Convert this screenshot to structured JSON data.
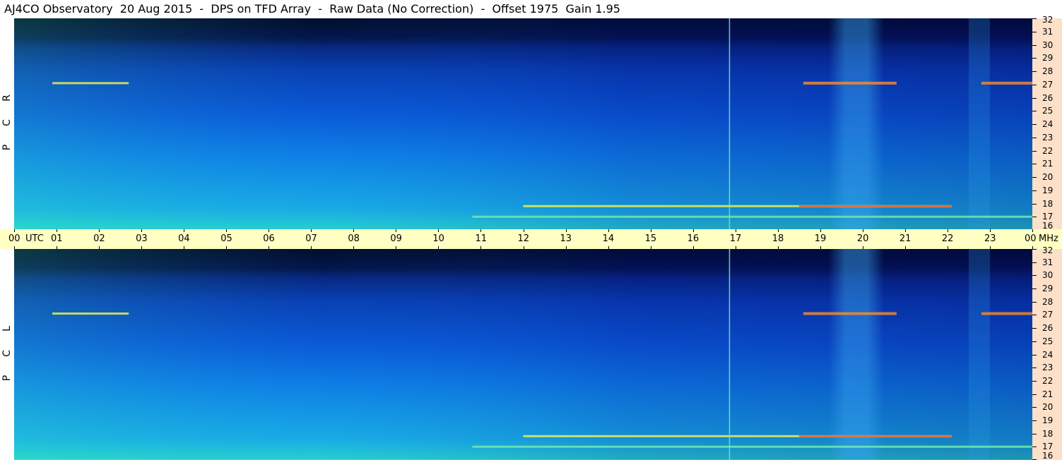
{
  "header": {
    "title": "AJ4CO Observatory  20 Aug 2015  -  DPS on TFD Array  -  Raw Data (No Correction)  -  Offset 1975  Gain 1.95"
  },
  "chart_data": [
    {
      "type": "heatmap",
      "polarization": "R C P",
      "xlabel": "UTC",
      "ylabel": "MHz",
      "x_range": [
        0,
        24
      ],
      "y_range": [
        16,
        32
      ],
      "x_ticks": [
        "00",
        "01",
        "02",
        "03",
        "04",
        "05",
        "06",
        "07",
        "08",
        "09",
        "10",
        "11",
        "12",
        "13",
        "14",
        "15",
        "16",
        "17",
        "18",
        "19",
        "20",
        "21",
        "22",
        "23",
        "00"
      ],
      "y_ticks": [
        "16",
        "17",
        "18",
        "19",
        "20",
        "21",
        "22",
        "23",
        "24",
        "25",
        "26",
        "27",
        "28",
        "29",
        "30",
        "31",
        "32"
      ],
      "colormap": [
        "#00002a",
        "#001a80",
        "#0a3cc8",
        "#0e64e0",
        "#1496e6",
        "#26c8e0",
        "#6ee8b4",
        "#e6f050",
        "#ff8c28",
        "#ff2a18"
      ],
      "features": {
        "interference_bands_mhz": [
          17.0,
          17.8,
          27.1
        ],
        "storm_window_utc": [
          19.2,
          20.5
        ],
        "vertical_spike_utc": 16.85
      }
    },
    {
      "type": "heatmap",
      "polarization": "L C P",
      "xlabel": "UTC",
      "ylabel": "MHz",
      "x_range": [
        0,
        24
      ],
      "y_range": [
        16,
        32
      ],
      "x_ticks": [
        "00",
        "01",
        "02",
        "03",
        "04",
        "05",
        "06",
        "07",
        "08",
        "09",
        "10",
        "11",
        "12",
        "13",
        "14",
        "15",
        "16",
        "17",
        "18",
        "19",
        "20",
        "21",
        "22",
        "23",
        "00"
      ],
      "y_ticks": [
        "16",
        "17",
        "18",
        "19",
        "20",
        "21",
        "22",
        "23",
        "24",
        "25",
        "26",
        "27",
        "28",
        "29",
        "30",
        "31",
        "32"
      ],
      "colormap": [
        "#00002a",
        "#001a80",
        "#0a3cc8",
        "#0e64e0",
        "#1496e6",
        "#26c8e0",
        "#6ee8b4",
        "#e6f050",
        "#ff8c28",
        "#ff2a18"
      ],
      "features": {
        "interference_bands_mhz": [
          17.0,
          17.8,
          27.1
        ],
        "storm_window_utc": [
          19.2,
          20.5
        ],
        "vertical_spike_utc": 16.85
      }
    }
  ],
  "time_axis": {
    "unit_label": "UTC",
    "freq_unit_label": "MHz"
  }
}
